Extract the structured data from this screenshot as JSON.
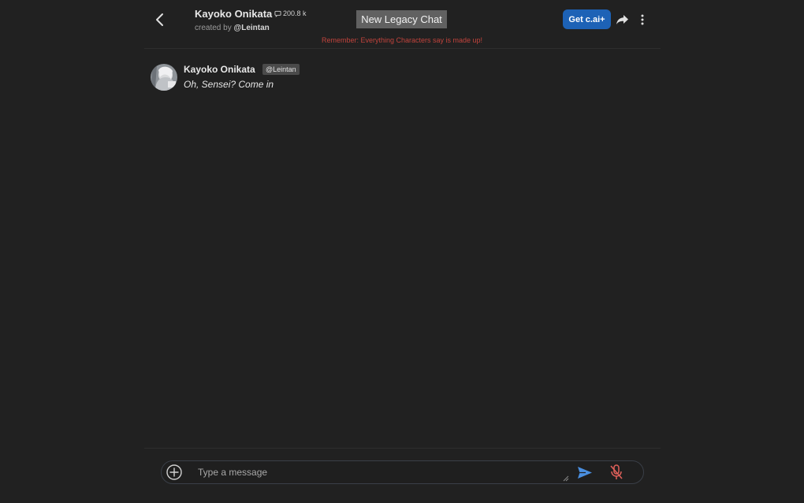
{
  "header": {
    "character_name": "Kayoko Onikata",
    "chat_count": "200.8 k",
    "created_by_prefix": "created by",
    "creator_handle": "@Leintan",
    "new_chat_label": "New Legacy Chat",
    "get_plus_label": "Get c.ai+",
    "disclaimer": "Remember: Everything Characters say is made up!"
  },
  "messages": [
    {
      "author": "Kayoko Onikata",
      "badge": "@Leintan",
      "text": "Oh, Sensei? Come in"
    }
  ],
  "composer": {
    "placeholder": "Type a message"
  },
  "icons": {
    "back": "chevron-left-icon",
    "chat_count": "chat-bubble-icon",
    "share": "share-arrow-icon",
    "more": "more-vertical-icon",
    "add": "plus-circle-icon",
    "send": "send-icon",
    "mic": "mic-off-icon"
  },
  "colors": {
    "background": "#212121",
    "accent": "#1d62b6",
    "send": "#4a8fe0",
    "disclaimer": "#c0433c",
    "mic_off": "#e0605a",
    "button_gray": "#616161"
  }
}
